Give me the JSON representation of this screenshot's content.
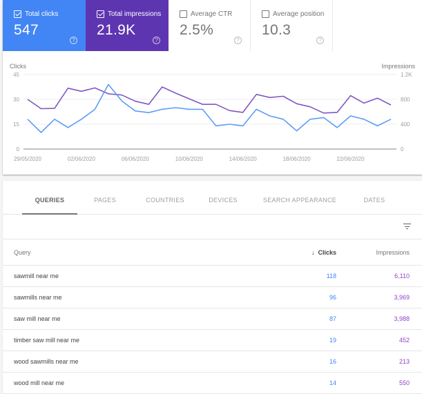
{
  "metrics": [
    {
      "label": "Total clicks",
      "value": "547",
      "checked": true,
      "color": "#4285f4"
    },
    {
      "label": "Total impressions",
      "value": "21.9K",
      "checked": true,
      "color": "#5e35b1"
    },
    {
      "label": "Average CTR",
      "value": "2.5%",
      "checked": false
    },
    {
      "label": "Average position",
      "value": "10.3",
      "checked": false
    }
  ],
  "help_glyph": "?",
  "chart_data": {
    "type": "line",
    "left_axis_title": "Clicks",
    "right_axis_title": "Impressions",
    "left_ticks": [
      "0",
      "15",
      "30",
      "45"
    ],
    "left_tick_values": [
      0,
      15,
      30,
      45
    ],
    "right_ticks": [
      "0",
      "400",
      "800",
      "1.2K"
    ],
    "right_tick_values": [
      0,
      400,
      800,
      1200
    ],
    "ylim_left": [
      0,
      45
    ],
    "ylim_right": [
      0,
      1200
    ],
    "x_tick_labels": [
      "29/05/2020",
      "02/06/2020",
      "06/06/2020",
      "10/06/2020",
      "14/06/2020",
      "18/06/2020",
      "22/06/2020"
    ],
    "x_tick_indices": [
      0,
      4,
      8,
      12,
      16,
      20,
      24
    ],
    "x": [
      "29/05/2020",
      "30/05/2020",
      "31/05/2020",
      "01/06/2020",
      "02/06/2020",
      "03/06/2020",
      "04/06/2020",
      "05/06/2020",
      "06/06/2020",
      "07/06/2020",
      "08/06/2020",
      "09/06/2020",
      "10/06/2020",
      "11/06/2020",
      "12/06/2020",
      "13/06/2020",
      "14/06/2020",
      "15/06/2020",
      "16/06/2020",
      "17/06/2020",
      "18/06/2020",
      "19/06/2020",
      "20/06/2020",
      "21/06/2020",
      "22/06/2020",
      "23/06/2020",
      "24/06/2020",
      "25/06/2020"
    ],
    "grid": true,
    "legend": "none",
    "series": [
      {
        "name": "Clicks",
        "axis": "left",
        "color": "#5c9cf5",
        "values": [
          18,
          10,
          18,
          13,
          18,
          24,
          39,
          29,
          23,
          22,
          24,
          25,
          24,
          24,
          14,
          15,
          14,
          24,
          20,
          18,
          11,
          18,
          19,
          13,
          20,
          18,
          14,
          18
        ]
      },
      {
        "name": "Impressions",
        "axis": "right",
        "color": "#7e57c2",
        "values": [
          800,
          650,
          655,
          980,
          930,
          985,
          890,
          870,
          770,
          720,
          1000,
          900,
          810,
          720,
          720,
          620,
          590,
          880,
          830,
          850,
          730,
          680,
          580,
          590,
          860,
          740,
          820,
          710
        ]
      }
    ]
  },
  "tabs": [
    {
      "label": "QUERIES",
      "active": true
    },
    {
      "label": "PAGES",
      "active": false
    },
    {
      "label": "COUNTRIES",
      "active": false
    },
    {
      "label": "DEVICES",
      "active": false
    },
    {
      "label": "SEARCH APPEARANCE",
      "active": false
    },
    {
      "label": "DATES",
      "active": false
    }
  ],
  "table": {
    "columns": {
      "query": "Query",
      "clicks": "Clicks",
      "impressions": "Impressions",
      "sort_glyph": "↓"
    },
    "rows": [
      {
        "query": "sawmill near me",
        "clicks": "118",
        "impressions": "6,110"
      },
      {
        "query": "sawmills near me",
        "clicks": "96",
        "impressions": "3,969"
      },
      {
        "query": "saw mill near me",
        "clicks": "87",
        "impressions": "3,988"
      },
      {
        "query": "timber saw mill near me",
        "clicks": "19",
        "impressions": "452"
      },
      {
        "query": "wood sawmills near me",
        "clicks": "16",
        "impressions": "213"
      },
      {
        "query": "wood mill near me",
        "clicks": "14",
        "impressions": "550"
      }
    ]
  }
}
